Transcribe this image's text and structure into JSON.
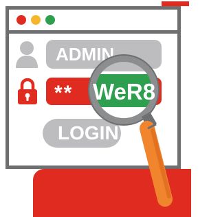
{
  "window": {
    "buttons": [
      "close",
      "minimize",
      "maximize"
    ]
  },
  "form": {
    "username_value": "ADMIN",
    "password_value": "**",
    "login_label": "LOGIN"
  },
  "magnifier": {
    "revealed_text": "WeR8"
  },
  "icons": {
    "user": "user-icon",
    "lock": "lock-icon",
    "magnifier": "magnifying-glass-icon"
  },
  "colors": {
    "accent_red": "#e02b20",
    "frame_gray": "#6e6f71",
    "field_gray": "#bdbdbf",
    "reveal_green": "#2e9e4f",
    "dot_red": "#e02b20",
    "dot_yellow": "#f6b62b",
    "dot_green": "#2e9e4f",
    "handle_orange": "#f0852e"
  }
}
